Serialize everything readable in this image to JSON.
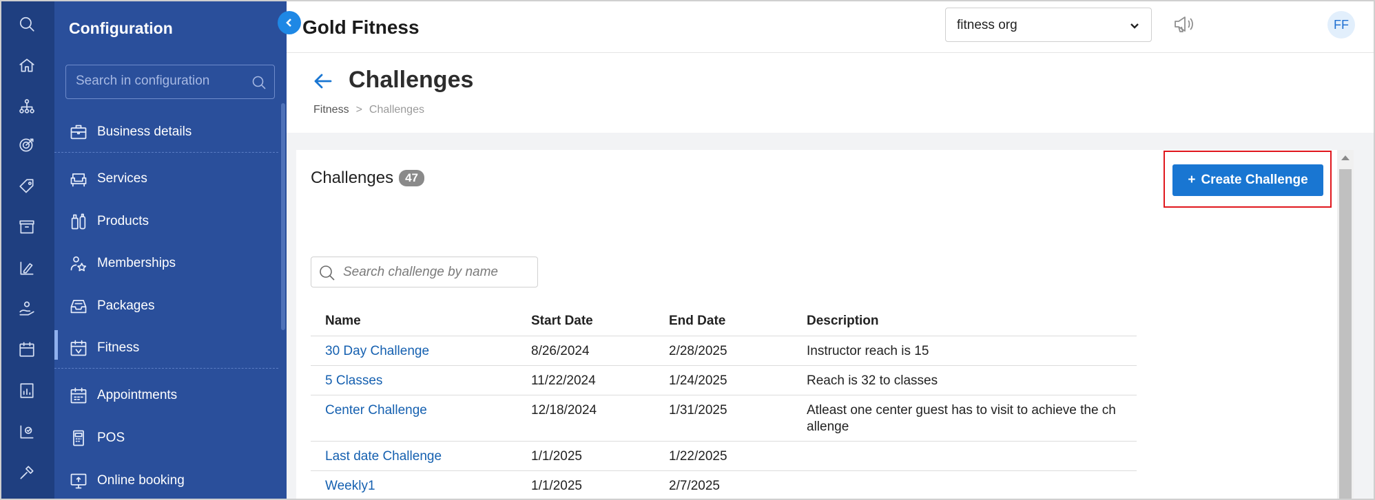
{
  "app": {
    "brand": "Gold Fitness",
    "org_selector": "fitness org",
    "avatar_initials": "FF"
  },
  "rail": {
    "icons": [
      "search-icon",
      "home-icon",
      "org-chart-icon",
      "target-icon",
      "tag-icon",
      "box-icon",
      "chart-pencil-icon",
      "hand-care-icon",
      "calendar-icon",
      "report-icon",
      "analytics-icon",
      "tools-icon"
    ]
  },
  "config": {
    "title": "Configuration",
    "search_placeholder": "Search in configuration",
    "items": [
      {
        "label": "Business details",
        "icon": "briefcase-icon"
      },
      {
        "label": "Services",
        "icon": "armchair-icon"
      },
      {
        "label": "Products",
        "icon": "bottles-icon"
      },
      {
        "label": "Memberships",
        "icon": "member-star-icon"
      },
      {
        "label": "Packages",
        "icon": "tray-icon"
      },
      {
        "label": "Fitness",
        "icon": "fitness-calendar-icon"
      },
      {
        "label": "Appointments",
        "icon": "calendar-icon"
      },
      {
        "label": "POS",
        "icon": "pos-terminal-icon"
      },
      {
        "label": "Online booking",
        "icon": "monitor-icon"
      }
    ],
    "active": "Fitness"
  },
  "page": {
    "title": "Challenges",
    "breadcrumb": [
      "Fitness",
      "Challenges"
    ],
    "breadcrumb_sep": ">"
  },
  "card": {
    "title": "Challenges",
    "count": "47",
    "create_button": "Create Challenge",
    "create_button_prefix": "+",
    "search_placeholder": "Search challenge by name"
  },
  "table": {
    "columns": [
      "Name",
      "Start Date",
      "End Date",
      "Description"
    ],
    "rows": [
      {
        "name": "30 Day Challenge",
        "start": "8/26/2024",
        "end": "2/28/2025",
        "description": "Instructor reach is 15"
      },
      {
        "name": "5 Classes",
        "start": "11/22/2024",
        "end": "1/24/2025",
        "description": "Reach is 32 to classes"
      },
      {
        "name": "Center Challenge",
        "start": "12/18/2024",
        "end": "1/31/2025",
        "description": "Atleast one center guest has to visit to achieve the ch allenge"
      },
      {
        "name": "Last date Challenge",
        "start": "1/1/2025",
        "end": "1/22/2025",
        "description": ""
      },
      {
        "name": "Weekly1",
        "start": "1/1/2025",
        "end": "2/7/2025",
        "description": ""
      }
    ]
  },
  "colors": {
    "rail": "#1f3f80",
    "sidebar": "#2a4f9b",
    "accent": "#1976d2",
    "link": "#1560b0",
    "highlight": "#e0161c"
  }
}
